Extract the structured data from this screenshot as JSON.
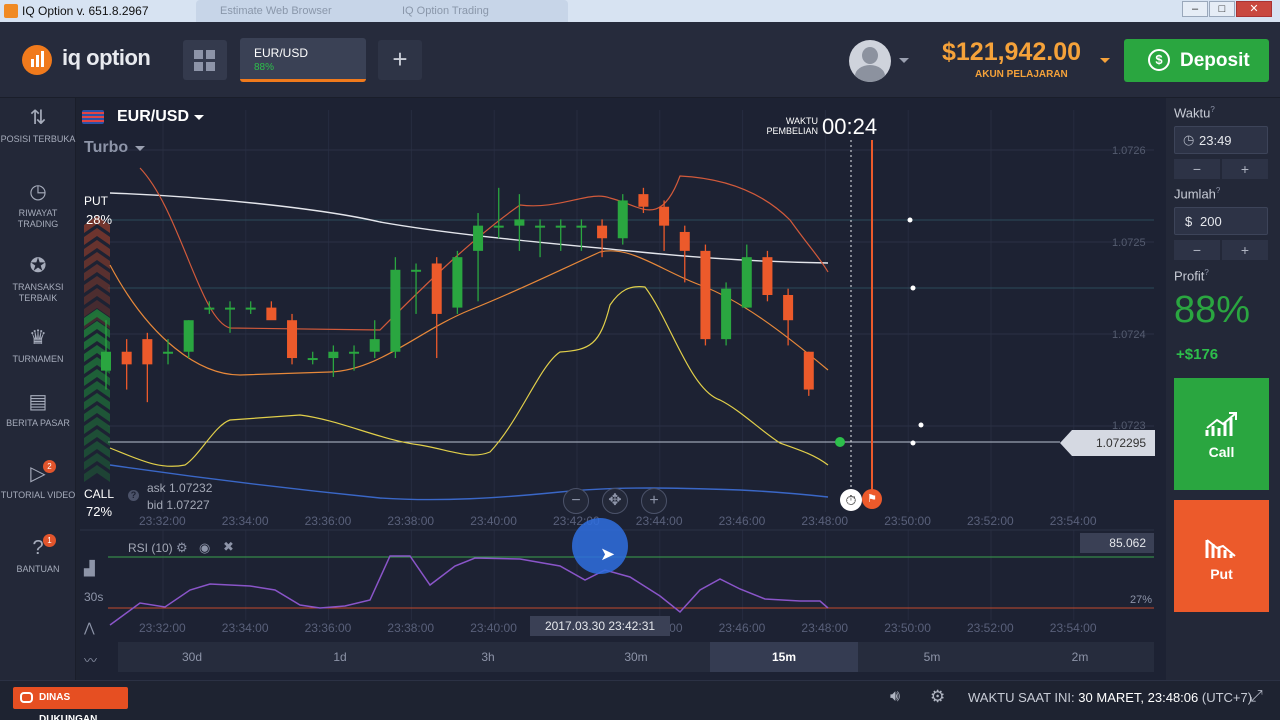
{
  "window": {
    "title": "IQ Option v. 651.8.2967",
    "bg_tabs": [
      "Estimate Web Browser",
      "IQ Option Trading"
    ]
  },
  "header": {
    "logo_text": "iq option",
    "asset_tab": {
      "name": "EUR/USD",
      "payout": "88%"
    },
    "balance": "$121,942.00",
    "account_type": "AKUN PELAJARAN",
    "deposit_label": "Deposit"
  },
  "sidebar": {
    "items": [
      {
        "label": "POSISI TERBUKA",
        "icon": "arrows-updown-icon"
      },
      {
        "label": "RIWAYAT TRADING",
        "icon": "history-icon"
      },
      {
        "label": "TRANSAKSI TERBAIK",
        "icon": "medal-icon"
      },
      {
        "label": "TURNAMEN",
        "icon": "trophy-icon"
      },
      {
        "label": "BERITA PASAR",
        "icon": "news-icon"
      },
      {
        "label": "TUTORIAL VIDEO",
        "icon": "play-icon",
        "badge": "2"
      },
      {
        "label": "BANTUAN",
        "icon": "help-icon",
        "badge": "1"
      }
    ]
  },
  "chart": {
    "pair": "EUR/USD",
    "mode": "Turbo",
    "put_label": "PUT",
    "put_pct": "28%",
    "call_label": "CALL",
    "call_pct": "72%",
    "ask": "ask 1.07232",
    "bid": "bid 1.07227",
    "purchase_time_label": "WAKTU PEMBELIAN",
    "countdown": "00:24",
    "current_price": "1.072295",
    "price_labels": [
      "1.0726",
      "1.0725",
      "1.0724",
      "1.0723"
    ],
    "time_ticks": [
      "23:32:00",
      "23:34:00",
      "23:36:00",
      "23:38:00",
      "23:40:00",
      "23:42:00",
      "23:44:00",
      "23:46:00",
      "23:48:00",
      "23:50:00",
      "23:52:00",
      "23:54:00"
    ],
    "rsi_label": "RSI (10)",
    "rsi_value": "85.062",
    "rsi_low": "27%",
    "crosshair_time": "2017.03.30 23:42:31",
    "candle_interval": "30s",
    "periods": [
      "30d",
      "1d",
      "3h",
      "30m",
      "15m",
      "5m",
      "2m"
    ],
    "active_period": "15m",
    "colors": {
      "up": "#2aa640",
      "down": "#ec5a2b",
      "bg": "#1d2233"
    }
  },
  "chart_data": {
    "type": "candlestick",
    "x": [
      "23:31:00",
      "23:31:30",
      "23:32:00",
      "23:32:30",
      "23:33:00",
      "23:33:30",
      "23:34:00",
      "23:34:30",
      "23:35:00",
      "23:35:30",
      "23:36:00",
      "23:36:30",
      "23:37:00",
      "23:37:30",
      "23:38:00",
      "23:38:30",
      "23:39:00",
      "23:39:30",
      "23:40:00",
      "23:40:30",
      "23:41:00",
      "23:41:30",
      "23:42:00",
      "23:42:30",
      "23:43:00",
      "23:43:30",
      "23:44:00",
      "23:44:30",
      "23:45:00",
      "23:45:30",
      "23:46:00",
      "23:46:30",
      "23:47:00",
      "23:47:30",
      "23:48:00"
    ],
    "ohlc": [
      [
        1.07233,
        1.07241,
        1.0723,
        1.07236
      ],
      [
        1.07236,
        1.07238,
        1.0723,
        1.07234
      ],
      [
        1.07238,
        1.07239,
        1.07228,
        1.07234
      ],
      [
        1.07236,
        1.07238,
        1.07234,
        1.07236
      ],
      [
        1.07236,
        1.07241,
        1.07235,
        1.07241
      ],
      [
        1.07243,
        1.07244,
        1.07242,
        1.07243
      ],
      [
        1.07243,
        1.07244,
        1.07239,
        1.07243
      ],
      [
        1.07243,
        1.07244,
        1.07242,
        1.07243
      ],
      [
        1.07243,
        1.07244,
        1.07242,
        1.07241
      ],
      [
        1.07241,
        1.07242,
        1.07234,
        1.07235
      ],
      [
        1.07235,
        1.07236,
        1.07234,
        1.07235
      ],
      [
        1.07235,
        1.07237,
        1.07232,
        1.07236
      ],
      [
        1.07236,
        1.07237,
        1.07233,
        1.07236
      ],
      [
        1.07236,
        1.07241,
        1.07235,
        1.07238
      ],
      [
        1.07236,
        1.07251,
        1.07235,
        1.07249
      ],
      [
        1.07249,
        1.0725,
        1.07242,
        1.07249
      ],
      [
        1.0725,
        1.07251,
        1.07235,
        1.07242
      ],
      [
        1.07243,
        1.07252,
        1.07242,
        1.07251
      ],
      [
        1.07252,
        1.07258,
        1.07244,
        1.07256
      ],
      [
        1.07256,
        1.07262,
        1.07254,
        1.07256
      ],
      [
        1.07256,
        1.07261,
        1.07252,
        1.07257
      ],
      [
        1.07256,
        1.07257,
        1.07251,
        1.07256
      ],
      [
        1.07256,
        1.07257,
        1.07252,
        1.07256
      ],
      [
        1.07256,
        1.07257,
        1.07252,
        1.07256
      ],
      [
        1.07256,
        1.07257,
        1.07251,
        1.07254
      ],
      [
        1.07254,
        1.07261,
        1.07253,
        1.0726
      ],
      [
        1.07261,
        1.07262,
        1.07258,
        1.07259
      ],
      [
        1.07259,
        1.0726,
        1.07252,
        1.07256
      ],
      [
        1.07255,
        1.07256,
        1.07247,
        1.07252
      ],
      [
        1.07252,
        1.07253,
        1.07237,
        1.07238
      ],
      [
        1.07238,
        1.07247,
        1.07237,
        1.07246
      ],
      [
        1.07243,
        1.07253,
        1.07243,
        1.07251
      ],
      [
        1.07251,
        1.07252,
        1.07244,
        1.07245
      ],
      [
        1.07245,
        1.07246,
        1.07237,
        1.07241
      ],
      [
        1.07236,
        1.07236,
        1.07229,
        1.0723
      ]
    ],
    "ylim": [
      1.07222,
      1.07268
    ]
  },
  "panel": {
    "time_label": "Waktu",
    "time_value": "23:49",
    "amount_label": "Jumlah",
    "amount_currency": "$",
    "amount_value": "200",
    "profit_label": "Profit",
    "profit_pct": "88%",
    "profit_amount": "+$176",
    "call_label": "Call",
    "put_label": "Put",
    "minus": "−",
    "plus": "+"
  },
  "footer": {
    "support_label": "DINAS DUKUNGAN",
    "time_label": "WAKTU SAAT INI:",
    "time_value": "30 MARET, 23:48:06",
    "tz": "(UTC+7)"
  }
}
